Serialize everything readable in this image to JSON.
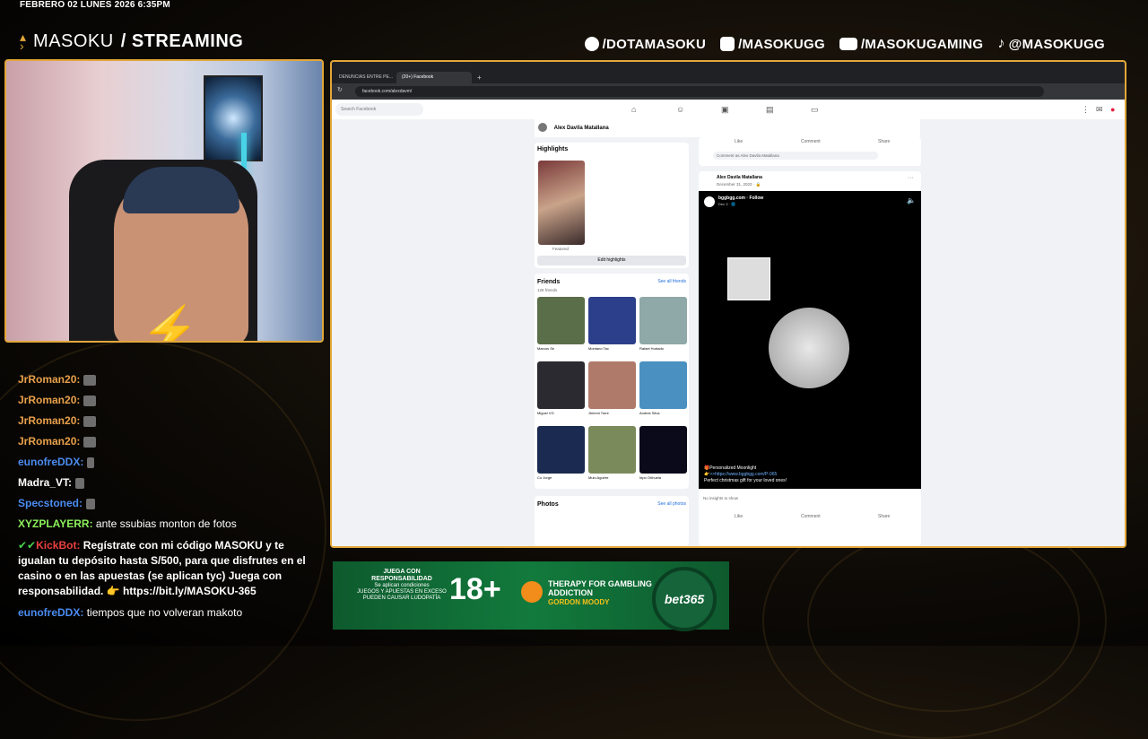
{
  "overlay": {
    "date": "FEBRERO 02 LUNES 2026 6:35PM",
    "brand_prefix": "MASOKU",
    "brand_suffix": "/ STREAMING",
    "socials": [
      {
        "icon": "facebook-icon",
        "label": "/DOTAMASOKU"
      },
      {
        "icon": "instagram-icon",
        "label": "/MASOKUGG"
      },
      {
        "icon": "youtube-icon",
        "label": "/MASOKUGAMING"
      },
      {
        "icon": "tiktok-icon",
        "label": "@MASOKUGG"
      }
    ],
    "accent_color": "#e2a73a"
  },
  "chat": [
    {
      "user": "JrRoman20:",
      "color": "#e8a04a",
      "text": ""
    },
    {
      "user": "JrRoman20:",
      "color": "#e8a04a",
      "text": ""
    },
    {
      "user": "JrRoman20:",
      "color": "#e8a04a",
      "text": ""
    },
    {
      "user": "JrRoman20:",
      "color": "#e8a04a",
      "text": ""
    },
    {
      "user": "eunofreDDX:",
      "color": "#4a8cf0",
      "text": ""
    },
    {
      "user": "Madra_VT:",
      "color": "#ffffff",
      "text": ""
    },
    {
      "user": "Specstoned:",
      "color": "#4a8cf0",
      "text": ""
    },
    {
      "user": "XYZPLAYERR:",
      "color": "#8cf05a",
      "text": "ante ssubias monton de fotos"
    },
    {
      "user": "KickBot:",
      "color": "#e84040",
      "text": "Regístrate con mi código MASOKU y te igualan tu depósito hasta S/500, para que disfrutes en el casino o en las apuestas (se aplican tyc) Juega con responsabilidad. 👉 https://bit.ly/MASOKU-365"
    },
    {
      "user": "eunofreDDX:",
      "color": "#4a8cf0",
      "text": "tiempos que no volveran makoto"
    }
  ],
  "browser": {
    "tabs": [
      "DENUNCIAS ENTRE PE...",
      "(20+) Facebook"
    ],
    "url": "facebook.com/alexdavm/",
    "search_placeholder": "Search Facebook",
    "profile_name": "Alex Davila Matallana",
    "highlights_title": "Highlights",
    "highlight_label": "Featured",
    "edit_highlights": "Edit highlights",
    "friends_title": "Friends",
    "friends_count": "126 friends",
    "see_all_friends": "See all friends",
    "friends": [
      {
        "name": "Marcos Se",
        "color": "#5a6e4a"
      },
      {
        "name": "Montano Tac",
        "color": "#2b3f8a"
      },
      {
        "name": "Rafael Hurtado",
        "color": "#8fa8a8"
      },
      {
        "name": "Miguel VG",
        "color": "#2a2a30"
      },
      {
        "name": "Jhimmi Torre",
        "color": "#b07a6a"
      },
      {
        "name": "Andres Silva",
        "color": "#4a90c0"
      },
      {
        "name": "Co Jorge",
        "color": "#1a2a50"
      },
      {
        "name": "Mulu Aguirre",
        "color": "#7a8a5a"
      },
      {
        "name": "Iepo Orihuela",
        "color": "#0a0a1a"
      }
    ],
    "photos_title": "Photos",
    "see_all_photos": "See all photos",
    "like": "Like",
    "comment": "Comment",
    "share": "Share",
    "comment_as": "Comment as Alex Davila Matallana",
    "post_author": "Alex Davila Matallana",
    "post_date": "December 31, 2022 · 🔒",
    "video_source": "bggbgg.com · Follow",
    "video_sub": "Dec 3 · 🌐",
    "video_caption_1": "🎁Personalized Moonlight",
    "video_caption_2": "👉>>https://www.bggbgg.com/P-065",
    "video_caption_3": "Perfect christmas gift for your loved ones!",
    "no_insights": "No insights to show"
  },
  "ad": {
    "resp_title": "JUEGA CON RESPONSABILIDAD",
    "resp_sub": "Se aplican condiciones",
    "resp_body": "JUEGOS Y APUESTAS EN EXCESO PUEDEN CAUSAR LUDOPATÍA",
    "age": "18+",
    "therapy": "THERAPY FOR GAMBLING ADDICTION",
    "gm": "GORDON MOODY",
    "brand": "bet365"
  }
}
